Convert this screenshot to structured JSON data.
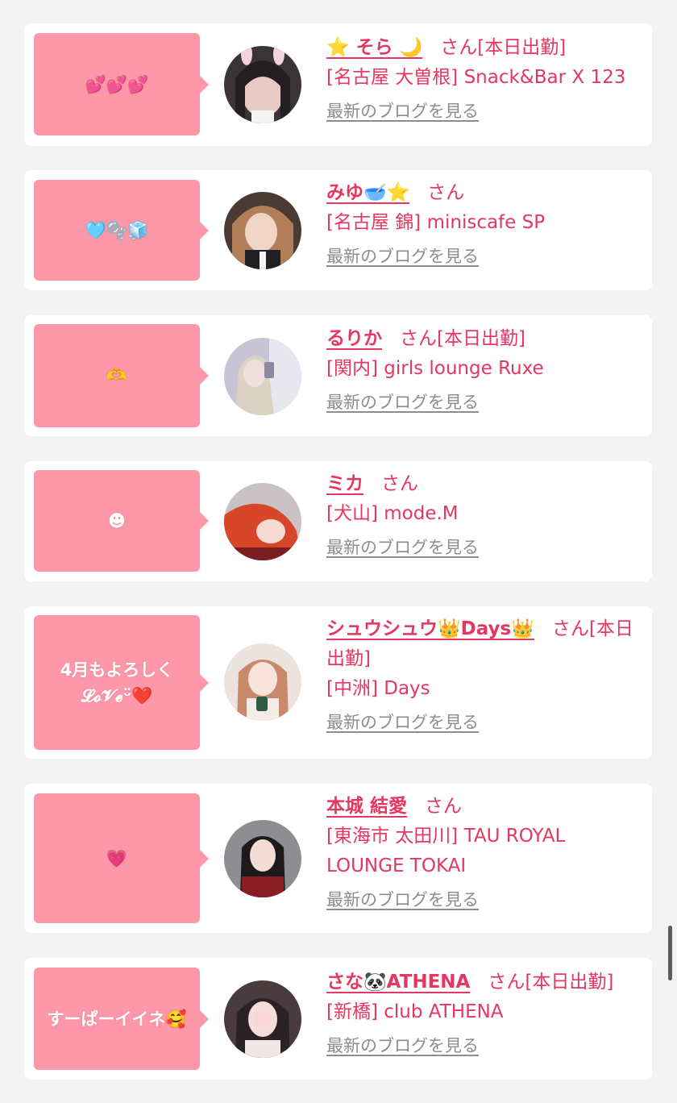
{
  "san_label": "さん",
  "blog_label": "最新のブログを見る",
  "colors": {
    "bubble": "#fe98a9",
    "accent": "#e5375f",
    "link_gray": "#8d8d8d",
    "background": "#f3f3f3"
  },
  "entries": [
    {
      "bubble": "💕💕💕",
      "name": "⭐️ そら 🌙",
      "status": "[本日出勤]",
      "shop": "[名古屋 大曽根] Snack&Bar X 123"
    },
    {
      "bubble": "🩵🫧🧊",
      "name": "みゆ🥣⭐️",
      "status": "",
      "shop": "[名古屋 錦] miniscafe SP"
    },
    {
      "bubble": "🫶",
      "name": "るりか",
      "status": "[本日出勤]",
      "shop": "[関内] girls lounge Ruxe"
    },
    {
      "bubble": "☻",
      "name": "ミカ",
      "status": "",
      "shop": "[犬山] mode.M"
    },
    {
      "bubble": "4月もよろしく\n𝓛𝓸𝓥𝓮ᵕ̈❤️",
      "name": "シュウシュウ👑Days👑",
      "status": "[本日出勤]",
      "shop": "[中洲] Days"
    },
    {
      "bubble": "💗",
      "name": "本城 結愛",
      "status": "",
      "shop": "[東海市 太田川] TAU ROYAL LOUNGE TOKAI"
    },
    {
      "bubble": "すーぱーイイネ🥰",
      "name": "さな🐼ATHENA",
      "status": "[本日出勤]",
      "shop": "[新橋] club ATHENA"
    }
  ]
}
